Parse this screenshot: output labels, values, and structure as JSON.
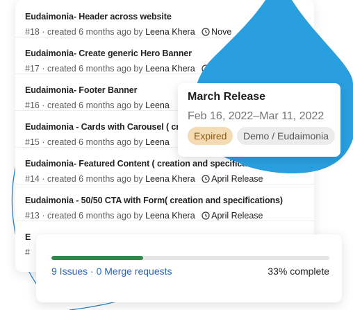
{
  "colors": {
    "drop_blue": "#2a9fe0",
    "outline_blue": "#2a86c8",
    "expired_badge_bg": "#f3dcb4",
    "progress_green": "#2f8a4a",
    "link_blue": "#2864b8"
  },
  "issues": [
    {
      "title": "Eudaimonia- Header across website",
      "number": "#18",
      "created": "· created 6 months ago by",
      "author": "Leena Khera",
      "milestone": "Nove"
    },
    {
      "title": "Eudaimonia- Create generic Hero Banner",
      "number": "#17",
      "created": "· created 6 months ago by",
      "author": "Leena Khera",
      "milestone": ""
    },
    {
      "title": "Eudaimonia- Footer Banner",
      "number": "#16",
      "created": "· created 6 months ago by",
      "author": "Leena",
      "milestone": ""
    },
    {
      "title": "Eudaimonia - Cards with Carousel ( creat",
      "number": "#15",
      "created": "· created 6 months ago by",
      "author": "Leena",
      "milestone": ""
    },
    {
      "title": "Eudaimonia- Featured Content ( creation and specifications)",
      "number": "#14",
      "created": "· created 6 months ago by",
      "author": "Leena Khera",
      "milestone": "April Release"
    },
    {
      "title": "Eudaimonia - 50/50 CTA with Form( creation and specifications)",
      "number": "#13",
      "created": "· created 6 months ago by",
      "author": "Leena Khera",
      "milestone": "April Release"
    },
    {
      "title": "E",
      "number": "#",
      "created": "",
      "author": "",
      "milestone": ""
    }
  ],
  "milestone_popover": {
    "title": "March Release",
    "dates": "Feb 16, 2022–Mar 11, 2022",
    "status_badge": "Expired",
    "project_badge": "Demo / Eudaimonia"
  },
  "progress": {
    "fraction": 0.33,
    "summary": "9 Issues · 0 Merge requests",
    "percent_label": "33% complete"
  }
}
